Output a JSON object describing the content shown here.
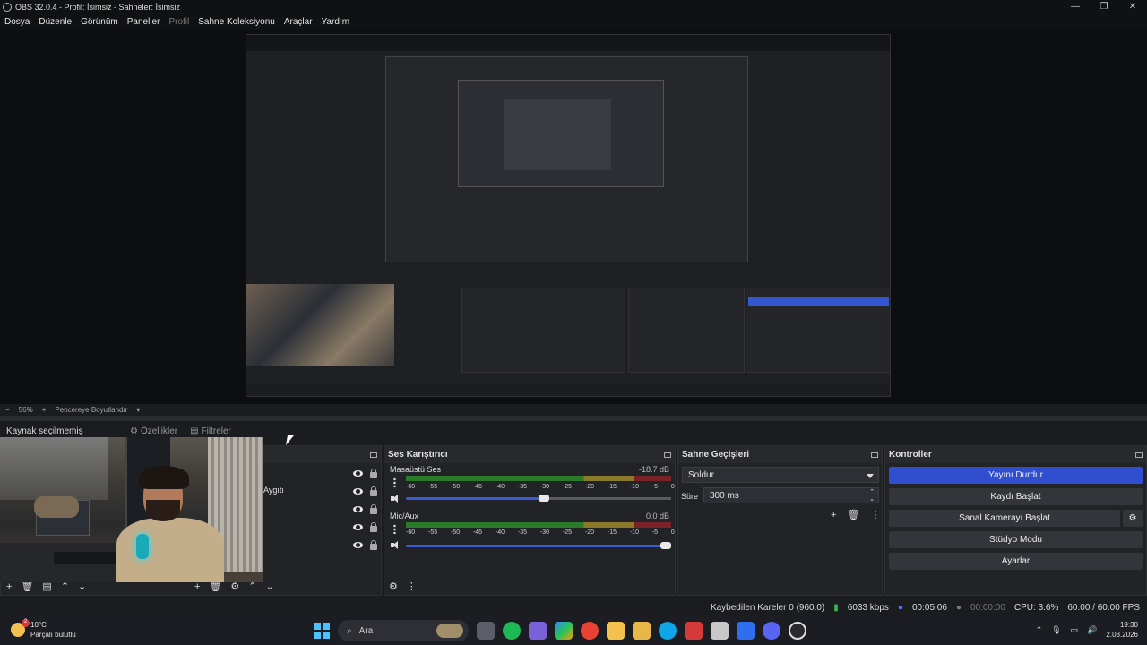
{
  "window": {
    "title": "OBS 32.0.4 - Profil: İsimsiz - Sahneler: İsimsiz",
    "minimize": "—",
    "maximize": "❐",
    "close": "✕"
  },
  "menu": [
    "Dosya",
    "Düzenle",
    "Görünüm",
    "Paneller",
    "Profil",
    "Sahne Koleksiyonu",
    "Araçlar",
    "Yardım"
  ],
  "zoom": {
    "minus": "−",
    "value": "56%",
    "plus": "+",
    "fit": "Pencereye Boyutlandır"
  },
  "source_toolbar": {
    "no_selection": "Kaynak seçilmemiş",
    "properties": "Özellikler",
    "filters": "Filtreler"
  },
  "sources": {
    "partial_label": "n Aygıtı",
    "rows": 5
  },
  "mixer": {
    "title": "Ses Karıştırıcı",
    "tracks": [
      {
        "name": "Masaüstü Ses",
        "db": "-18.7 dB",
        "volume_fraction": 0.52
      },
      {
        "name": "Mic/Aux",
        "db": "0.0 dB",
        "volume_fraction": 1.0
      }
    ],
    "ticks": [
      "-60",
      "-55",
      "-50",
      "-45",
      "-40",
      "-35",
      "-30",
      "-25",
      "-20",
      "-15",
      "-10",
      "-5",
      "0"
    ]
  },
  "transitions": {
    "title": "Sahne Geçişleri",
    "selected": "Soldur",
    "duration_label": "Süre",
    "duration_value": "300 ms"
  },
  "controls": {
    "title": "Kontroller",
    "buttons": [
      "Yayını Durdur",
      "Kaydı Başlat",
      "Sanal Kamerayı Başlat",
      "Stüdyo Modu",
      "Ayarlar"
    ]
  },
  "status": {
    "dropped": "Kaybedilen Kareler 0 (960.0)",
    "bitrate": "6033 kbps",
    "stream_time": "00:05:06",
    "rec_time": "00:00:00",
    "cpu": "CPU: 3.6%",
    "fps": "60.00 / 60.00 FPS"
  },
  "taskbar": {
    "temp": "10°C",
    "weather": "Parçalı bulutlu",
    "search": "Ara",
    "time": "19:30",
    "date": "2.03.2026"
  },
  "colors": {
    "accent": "#2f4fd0",
    "meter_green": "#2a7a2a",
    "meter_yellow": "#8a7a2a",
    "meter_red": "#7a2228"
  }
}
